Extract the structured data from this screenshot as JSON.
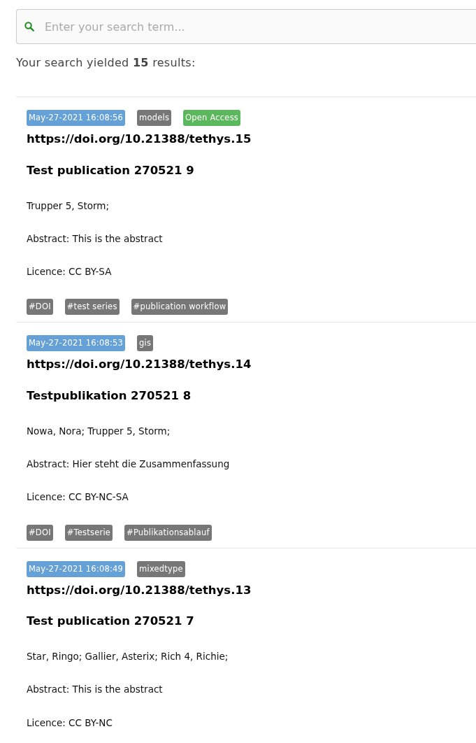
{
  "search": {
    "placeholder": "Enter your search term..."
  },
  "summary": "Your search yielded **15** results:",
  "results": [
    {
      "badges": [
        {
          "kind": "date",
          "text": "May-27-2021 16:08:56"
        },
        {
          "kind": "type",
          "text": "models"
        },
        {
          "kind": "access",
          "text": "Open Access"
        }
      ],
      "doi": "https://doi.org/10.21388/tethys.15",
      "title": "Test publication 270521 9",
      "authors": "Trupper 5, Storm;",
      "abstract": "Abstract: This is the abstract",
      "licence": "Licence: CC BY-SA",
      "tags": [
        "#DOI",
        "#test series",
        "#publication workflow"
      ]
    },
    {
      "badges": [
        {
          "kind": "date",
          "text": "May-27-2021 16:08:53"
        },
        {
          "kind": "type",
          "text": "gis"
        }
      ],
      "doi": "https://doi.org/10.21388/tethys.14",
      "title": "Testpublikation 270521 8",
      "authors": "Nowa, Nora; Trupper 5, Storm;",
      "abstract": "Abstract: Hier steht die Zusammenfassung",
      "licence": "Licence: CC BY-NC-SA",
      "tags": [
        "#DOI",
        "#Testserie",
        "#Publikationsablauf"
      ]
    },
    {
      "badges": [
        {
          "kind": "date",
          "text": "May-27-2021 16:08:49"
        },
        {
          "kind": "type",
          "text": "mixedtype"
        }
      ],
      "doi": "https://doi.org/10.21388/tethys.13",
      "title": "Test publication 270521 7",
      "authors": "Star, Ringo; Gallier, Asterix; Rich 4, Richie;",
      "abstract": "Abstract: This is the abstract",
      "licence": "Licence: CC BY-NC"
    }
  ]
}
